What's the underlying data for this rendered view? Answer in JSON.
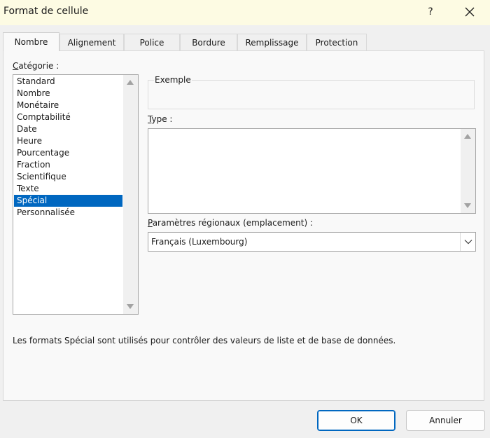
{
  "window": {
    "title": "Format de cellule",
    "help_label": "?"
  },
  "tabs": [
    {
      "label": "Nombre",
      "active": true
    },
    {
      "label": "Alignement"
    },
    {
      "label": "Police"
    },
    {
      "label": "Bordure"
    },
    {
      "label": "Remplissage"
    },
    {
      "label": "Protection"
    }
  ],
  "category": {
    "label_first": "C",
    "label_rest": "atégorie :",
    "items": [
      "Standard",
      "Nombre",
      "Monétaire",
      "Comptabilité",
      "Date",
      "Heure",
      "Pourcentage",
      "Fraction",
      "Scientifique",
      "Texte",
      "Spécial",
      "Personnalisée"
    ],
    "selected": "Spécial"
  },
  "example": {
    "label": "Exemple"
  },
  "type": {
    "label_first": "T",
    "label_rest": "ype :"
  },
  "locale": {
    "label_first": "P",
    "label_rest": "aramètres régionaux (emplacement) :",
    "value": "Français (Luxembourg)"
  },
  "description": "Les formats Spécial sont utilisés pour contrôler des valeurs de liste et de base de données.",
  "buttons": {
    "ok": "OK",
    "cancel": "Annuler"
  },
  "colors": {
    "titlebar": "#fdfbe3",
    "selection": "#0067c0",
    "dialog_bg": "#f0f0f0"
  }
}
